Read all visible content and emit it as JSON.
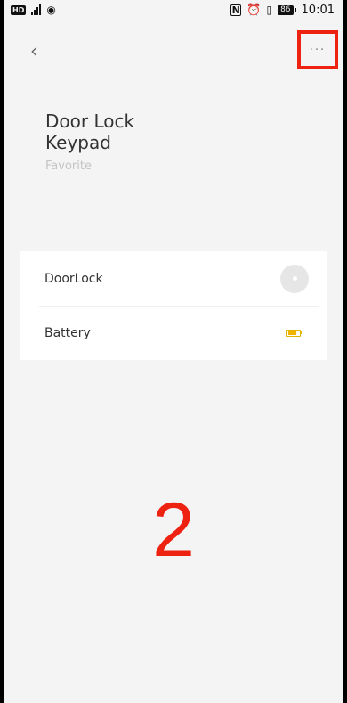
{
  "status_bar": {
    "hd_label": "HD",
    "network_label": "4G",
    "battery_level": "86",
    "time": "10:01"
  },
  "header": {
    "back_icon": "chevron-left-icon",
    "more_label": "···"
  },
  "device": {
    "title": "Door Lock Keypad",
    "subtitle": "Favorite"
  },
  "card": {
    "rows": [
      {
        "label": "DoorLock",
        "control": "lock-toggle-icon"
      },
      {
        "label": "Battery",
        "control": "battery-icon",
        "level_fraction": 0.75
      }
    ]
  },
  "annotation": {
    "number": "2",
    "color": "#ee2211"
  }
}
